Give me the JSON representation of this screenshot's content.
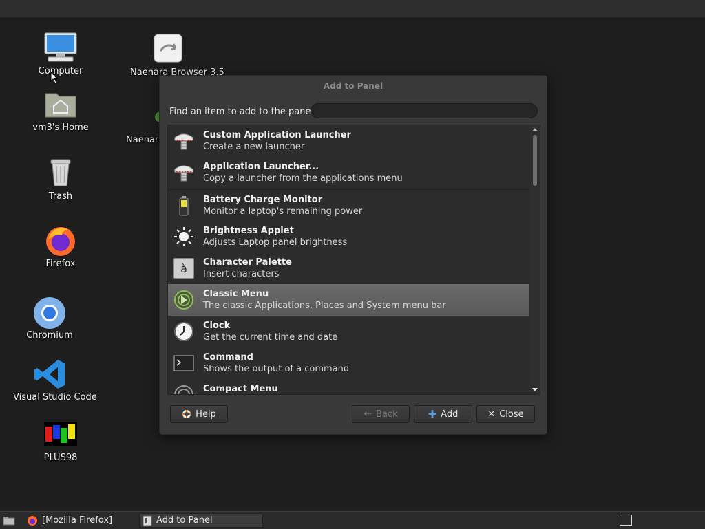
{
  "desktop": {
    "icons": [
      {
        "label": "Computer",
        "icon": "computer-icon"
      },
      {
        "label": "Naenara Browser 3.5",
        "icon": "browser-icon"
      },
      {
        "label": "vm3's Home",
        "icon": "home-folder-icon"
      },
      {
        "label": "Naenara",
        "icon": "naenara-icon"
      },
      {
        "label": "Trash",
        "icon": "trash-icon"
      },
      {
        "label": "Firefox",
        "icon": "firefox-icon"
      },
      {
        "label": "Chromium",
        "icon": "chromium-icon"
      },
      {
        "label": "Visual Studio Code",
        "icon": "vscode-icon"
      },
      {
        "label": "PLUS98",
        "icon": "plus98-icon"
      }
    ]
  },
  "dialog": {
    "title": "Add to Panel",
    "find_label": "Find an item to add to the panel:",
    "search_value": "",
    "items": [
      {
        "name": "Custom Application Launcher",
        "desc": "Create a new launcher",
        "icon": "launcher-icon"
      },
      {
        "name": "Application Launcher...",
        "desc": "Copy a launcher from the applications menu",
        "icon": "launcher-icon"
      },
      {
        "name": "Battery Charge Monitor",
        "desc": "Monitor a laptop's remaining power",
        "icon": "battery-icon"
      },
      {
        "name": "Brightness Applet",
        "desc": "Adjusts Laptop panel brightness",
        "icon": "brightness-icon"
      },
      {
        "name": "Character Palette",
        "desc": "Insert characters",
        "icon": "character-icon",
        "glyph": "à"
      },
      {
        "name": "Classic Menu",
        "desc": "The classic Applications, Places and System menu bar",
        "icon": "menu-icon",
        "selected": true
      },
      {
        "name": "Clock",
        "desc": "Get the current time and date",
        "icon": "clock-icon"
      },
      {
        "name": "Command",
        "desc": "Shows the output of a command",
        "icon": "terminal-icon"
      },
      {
        "name": "Compact Menu",
        "desc": "",
        "icon": "menu-icon"
      }
    ],
    "buttons": {
      "help": "Help",
      "back": "Back",
      "add": "Add",
      "close": "Close"
    }
  },
  "taskbar": {
    "tasks": [
      {
        "label": "[Mozilla Firefox]"
      },
      {
        "label": "Add to Panel"
      }
    ]
  }
}
